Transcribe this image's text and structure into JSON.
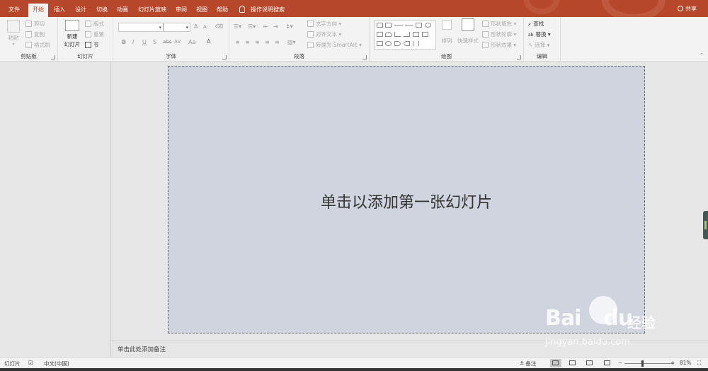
{
  "tabs": {
    "file": "文件",
    "home": "开始",
    "insert": "插入",
    "design": "设计",
    "transitions": "切换",
    "animations": "动画",
    "slideshow": "幻灯片放映",
    "review": "审阅",
    "view": "视图",
    "help": "帮助"
  },
  "tell_me": "操作说明搜索",
  "share": "共享",
  "ribbon": {
    "clipboard": {
      "label": "剪贴板",
      "paste": "粘贴",
      "cut": "剪切",
      "copy": "复制",
      "format_painter": "格式刷"
    },
    "slides": {
      "label": "幻灯片",
      "new_slide_1": "新建",
      "new_slide_2": "幻灯片",
      "layout": "版式",
      "reset": "重置",
      "section": "节"
    },
    "font": {
      "label": "字体",
      "bold": "B",
      "italic": "I",
      "underline": "U",
      "shadow": "S",
      "strike": "abc",
      "spacing": "AV",
      "case": "Aa",
      "color": "A",
      "grow": "A",
      "shrink": "A"
    },
    "paragraph": {
      "label": "段落",
      "text_direction": "文字方向",
      "align_text": "对齐文本",
      "smartart": "转换为 SmartArt"
    },
    "drawing": {
      "label": "绘图",
      "arrange": "排列",
      "quick_styles": "快速样式",
      "shape_fill": "形状填充",
      "shape_outline": "形状轮廓",
      "shape_effects": "形状效果"
    },
    "editing": {
      "label": "编辑",
      "find": "查找",
      "replace": "替换",
      "select": "选择"
    }
  },
  "slide": {
    "placeholder": "单击以添加第一张幻灯片"
  },
  "notes_placeholder": "单击此处添加备注",
  "status": {
    "slide": "幻灯片",
    "language": "中文(中国)",
    "notes": "备注",
    "zoom": "81%",
    "zoom_minus": "−",
    "zoom_plus": "+"
  },
  "watermark": {
    "brand": "Bai",
    "brand2": "du",
    "cn": "经验",
    "url": "jingyan.baidu.com"
  }
}
